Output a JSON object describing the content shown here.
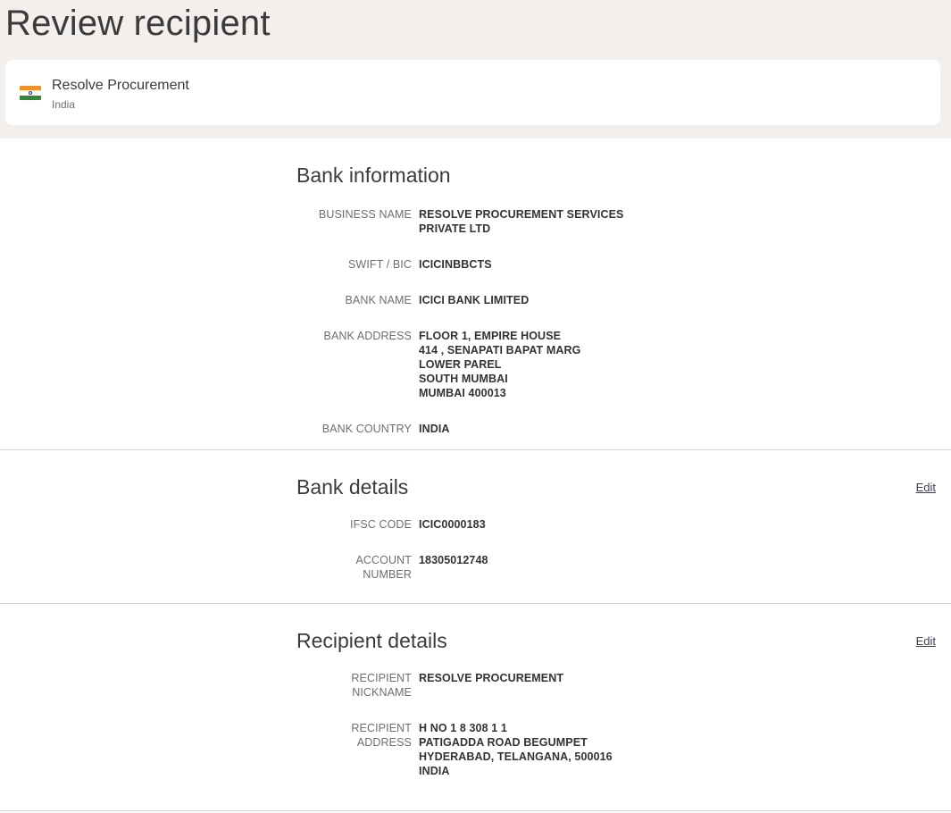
{
  "page": {
    "title": "Review recipient"
  },
  "recipient_card": {
    "name": "Resolve Procurement",
    "country": "India",
    "flag_icon": "india-flag-icon"
  },
  "bank_information": {
    "title": "Bank information",
    "rows": [
      {
        "label": "BUSINESS NAME",
        "value": "RESOLVE PROCUREMENT SERVICES\nPRIVATE LTD"
      },
      {
        "label": "SWIFT / BIC",
        "value": "ICICINBBCTS"
      },
      {
        "label": "BANK NAME",
        "value": "ICICI BANK LIMITED"
      },
      {
        "label": "BANK ADDRESS",
        "value": "FLOOR 1, EMPIRE HOUSE\n414 , SENAPATI BAPAT MARG\nLOWER PAREL\nSOUTH MUMBAI\nMUMBAI 400013"
      },
      {
        "label": "BANK COUNTRY",
        "value": "INDIA"
      }
    ]
  },
  "bank_details": {
    "title": "Bank details",
    "edit_label": "Edit",
    "rows": [
      {
        "label": "IFSC CODE",
        "value": "ICIC0000183"
      },
      {
        "label": "ACCOUNT\nNUMBER",
        "value": "18305012748"
      }
    ]
  },
  "recipient_details": {
    "title": "Recipient details",
    "edit_label": "Edit",
    "rows": [
      {
        "label": "RECIPIENT\nNICKNAME",
        "value": "RESOLVE PROCUREMENT"
      },
      {
        "label": "RECIPIENT\nADDRESS",
        "value": "H NO 1 8 308 1 1\nPATIGADDA ROAD BEGUMPET\nHYDERABAD, TELANGANA, 500016\nINDIA"
      }
    ]
  }
}
